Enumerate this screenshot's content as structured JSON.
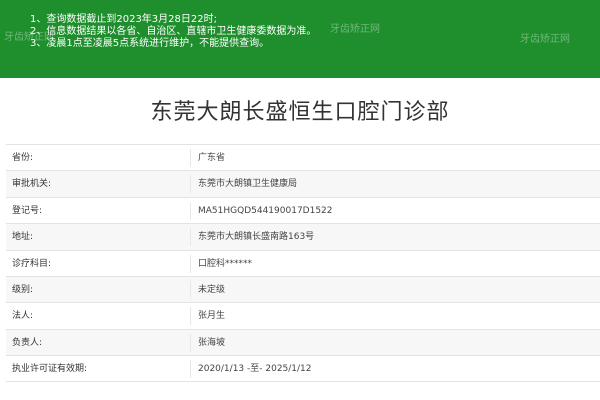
{
  "notice": {
    "lines": [
      "1、查询数据截止到2023年3月28日22时;",
      "2、信息数据结果以各省、自治区、直辖市卫生健康委数据为准。",
      "3、凌晨1点至凌晨5点系统进行维护，不能提供查询。"
    ]
  },
  "clinic": {
    "title": "东莞大朗长盛恒生口腔门诊部"
  },
  "info": {
    "rows": [
      {
        "label": "省份:",
        "value": "广东省"
      },
      {
        "label": "审批机关:",
        "value": "东莞市大朗镇卫生健康局"
      },
      {
        "label": "登记号:",
        "value": "MA51HGQD544190017D1522"
      },
      {
        "label": "地址:",
        "value": "东莞市大朗镇长盛南路163号"
      },
      {
        "label": "诊疗科目:",
        "value": "口腔科******"
      },
      {
        "label": "级别:",
        "value": "未定级"
      },
      {
        "label": "法人:",
        "value": "张月生"
      },
      {
        "label": "负责人:",
        "value": "张海坡"
      },
      {
        "label": "执业许可证有效期:",
        "value": "2020/1/13 -至- 2025/1/12"
      }
    ]
  },
  "watermarks": [
    "牙齿矫正网",
    "牙齿矫正网",
    "牙齿矫正网"
  ]
}
